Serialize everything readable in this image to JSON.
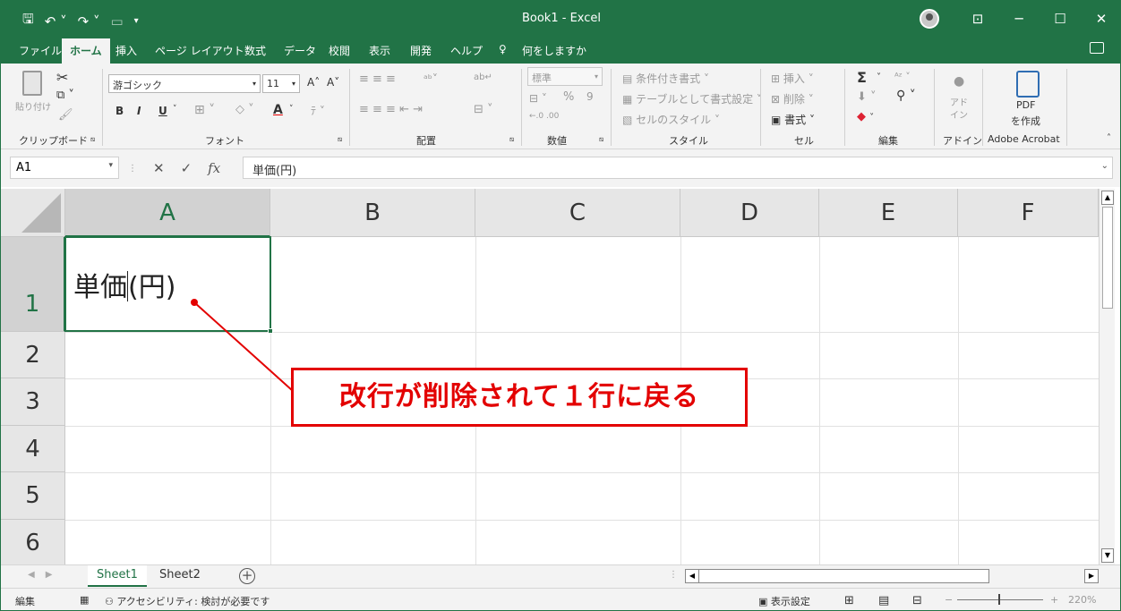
{
  "titlebar": {
    "title": "Book1  -  Excel",
    "save_icon": "floppy-disk-icon",
    "undo_icon": "undo-icon",
    "redo_icon": "redo-icon",
    "minimize": "─",
    "maximize": "☐",
    "close": "✕",
    "ribbon_display": "⊡"
  },
  "menu": {
    "tabs": [
      "ファイル",
      "ホーム",
      "挿入",
      "ページ レイアウト",
      "数式",
      "データ",
      "校閲",
      "表示",
      "開発",
      "ヘルプ"
    ],
    "tell_me": "何をしますか",
    "active_index": 1
  },
  "ribbon": {
    "clipboard": {
      "paste": "貼り付け",
      "label": "クリップボード"
    },
    "font": {
      "name": "游ゴシック",
      "size": "11",
      "bold": "B",
      "italic": "I",
      "underline": "U",
      "label": "フォント"
    },
    "alignment": {
      "label": "配置"
    },
    "number": {
      "format": "標準",
      "percent": "%",
      "comma": "9",
      "label": "数値"
    },
    "styles": {
      "conditional": "条件付き書式",
      "table": "テーブルとして書式設定",
      "cell_styles": "セルのスタイル",
      "label": "スタイル"
    },
    "cells": {
      "insert": "挿入",
      "delete": "削除",
      "format": "書式",
      "label": "セル"
    },
    "editing": {
      "sum": "Σ",
      "label": "編集"
    },
    "addins": {
      "label": "アドイン",
      "name": "アド\nイン"
    },
    "acrobat": {
      "pdf": "PDF",
      "create": "を作成",
      "label": "Adobe Acrobat"
    }
  },
  "formula_bar": {
    "name_box": "A1",
    "cancel": "✕",
    "enter": "✓",
    "fx": "fx",
    "content": "単価(円)"
  },
  "grid": {
    "columns": [
      "A",
      "B",
      "C",
      "D",
      "E",
      "F"
    ],
    "rows": [
      "1",
      "2",
      "3",
      "4",
      "5",
      "6"
    ],
    "selected_col": "A",
    "selected_row": "1",
    "a1_before_caret": "単価",
    "a1_after_caret": "(円)"
  },
  "annotation": {
    "text": "改行が削除されて１行に戻る",
    "color": "#e30000"
  },
  "sheets": {
    "tabs": [
      "Sheet1",
      "Sheet2"
    ],
    "active": "Sheet1",
    "add": "+"
  },
  "status": {
    "mode": "編集",
    "accessibility": "アクセシビリティ: 検討が必要です",
    "display_settings": "表示設定",
    "zoom": "220%",
    "zoom_minus": "−",
    "zoom_plus": "+"
  },
  "colors": {
    "accent": "#217346",
    "ribbon_bg": "#f3f3f3",
    "header_bg": "#e6e6e6"
  }
}
